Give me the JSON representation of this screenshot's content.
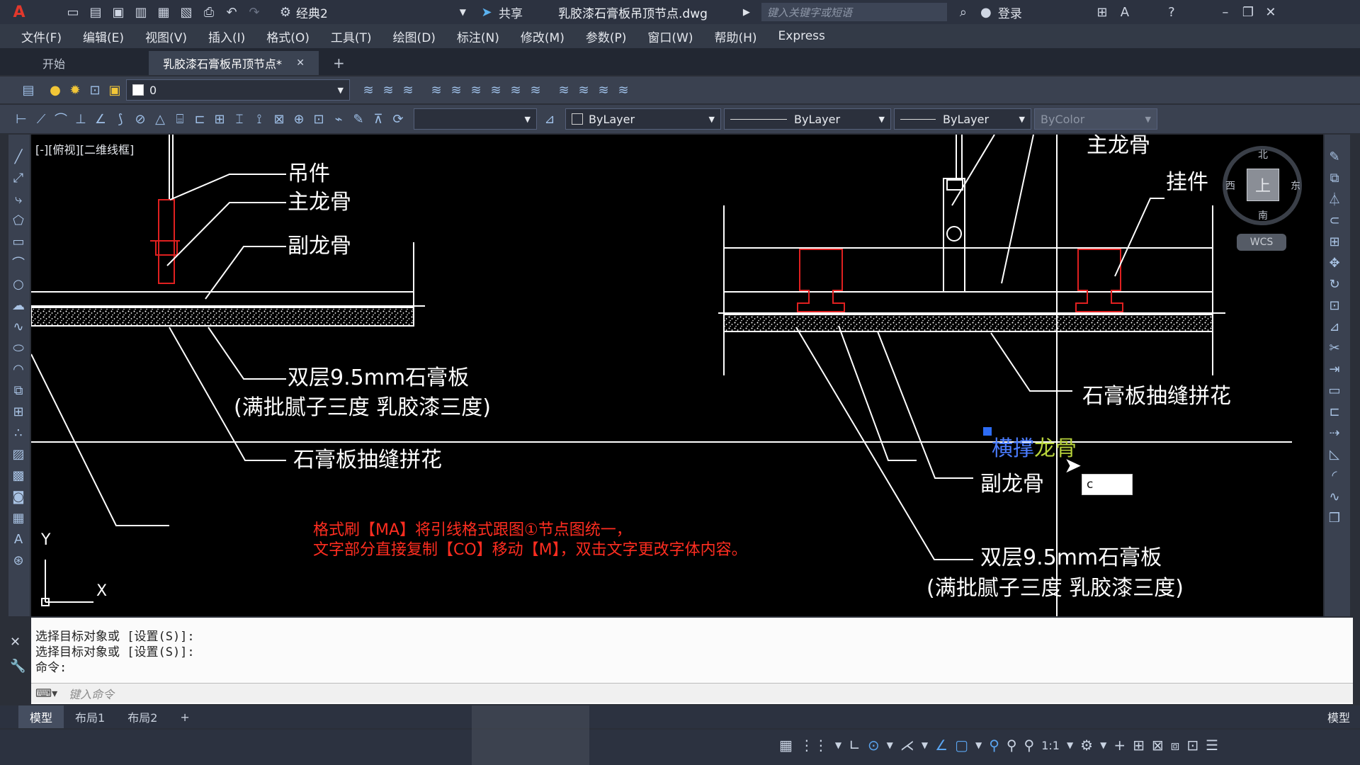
{
  "titlebar": {
    "workspace": "经典2",
    "share": "共享",
    "filename": "乳胶漆石膏板吊顶节点.dwg",
    "search_placeholder": "键入关键字或短语",
    "login": "登录"
  },
  "menu": [
    "文件(F)",
    "编辑(E)",
    "视图(V)",
    "插入(I)",
    "格式(O)",
    "工具(T)",
    "绘图(D)",
    "标注(N)",
    "修改(M)",
    "参数(P)",
    "窗口(W)",
    "帮助(H)",
    "Express"
  ],
  "tabs": {
    "start": "开始",
    "active": "乳胶漆石膏板吊顶节点*",
    "add": "+"
  },
  "ribbon": {
    "layer": "0",
    "color": "ByLayer",
    "linetype": "ByLayer",
    "lineweight": "ByLayer",
    "plotstyle": "ByColor"
  },
  "viewport": {
    "label": "[-][俯视][二维线框]",
    "wcs": "WCS",
    "compass": {
      "n": "北",
      "s": "南",
      "e": "东",
      "w": "西",
      "top": "上"
    },
    "ucs_y": "Y",
    "ucs_x": "X"
  },
  "drawing": {
    "left_labels": {
      "hanger": "吊件",
      "main_keel": "主龙骨",
      "sub_keel": "副龙骨",
      "board": "双层9.5mm石膏板",
      "finish": "(满批腻子三度 乳胶漆三度)",
      "joint": "石膏板抽缝拼花"
    },
    "right_labels": {
      "main_keel": "主龙骨",
      "hanging_piece": "挂件",
      "joint": "石膏板抽缝拼花",
      "cross_brace": "横撑",
      "keel": "龙骨",
      "sub_keel": "副龙骨",
      "board": "双层9.5mm石膏板",
      "finish": "(满批腻子三度 乳胶漆三度)"
    },
    "instruction_1": "格式刷【MA】将引线格式跟图①节点图统一，",
    "instruction_2": "文字部分直接复制【CO】移动【M】，双击文字更改字体内容。",
    "input_value": "c"
  },
  "commandline": {
    "history": [
      "选择目标对象或 [设置(S)]:",
      "选择目标对象或 [设置(S)]:",
      "命令:"
    ],
    "placeholder": "键入命令"
  },
  "layout_tabs": [
    "模型",
    "布局1",
    "布局2",
    "+"
  ],
  "status": {
    "model": "模型",
    "scale": "1:1"
  },
  "colors": {
    "accent": "#e03a2f",
    "keel": "#cc1a1a",
    "text": "#ffffff",
    "highlight": "#4a7cff"
  }
}
